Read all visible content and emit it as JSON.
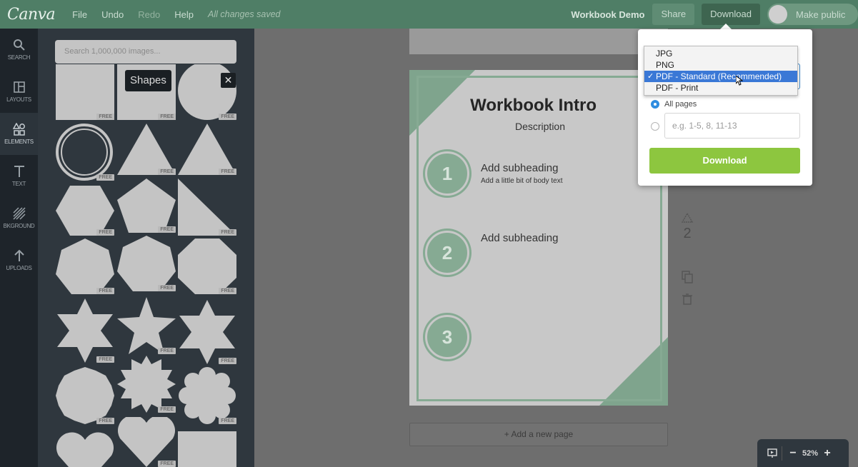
{
  "app": {
    "logo": "Canva",
    "menu": {
      "file": "File",
      "undo": "Undo",
      "redo": "Redo",
      "help": "Help",
      "saved_status": "All changes saved"
    },
    "doc_title": "Workbook Demo",
    "share_label": "Share",
    "download_label": "Download",
    "make_public_label": "Make public",
    "brand_color": "#4f7e66"
  },
  "rail": {
    "items": [
      {
        "label": "SEARCH",
        "icon": "search-icon"
      },
      {
        "label": "LAYOUTS",
        "icon": "layouts-icon"
      },
      {
        "label": "ELEMENTS",
        "icon": "elements-icon"
      },
      {
        "label": "TEXT",
        "icon": "text-icon"
      },
      {
        "label": "BKGROUND",
        "icon": "background-icon"
      },
      {
        "label": "UPLOADS",
        "icon": "upload-icon"
      }
    ]
  },
  "panel": {
    "search_placeholder": "Search 1,000,000 images...",
    "tooltip": "Shapes",
    "close_symbol": "✕",
    "free_label": "FREE"
  },
  "page": {
    "title": "Workbook Intro",
    "description": "Description",
    "steps": [
      {
        "number": "1",
        "subheading": "Add subheading",
        "body": "Add a little bit of body text"
      },
      {
        "number": "2",
        "subheading": "Add subheading",
        "body": ""
      },
      {
        "number": "3",
        "subheading": "",
        "body": ""
      }
    ],
    "page_number": "2",
    "add_page_label": "+ Add a new page",
    "accent_color": "#86aa93"
  },
  "download_popover": {
    "file_type_options": [
      "JPG",
      "PNG",
      "PDF - Standard (Recommended)",
      "PDF - Print"
    ],
    "selected_option": "PDF - Standard (Recommended)",
    "check_mark": "✓",
    "all_pages_label": "All pages",
    "range_placeholder": "e.g. 1-5, 8, 11-13",
    "button_label": "Download",
    "button_color": "#8dc63f"
  },
  "zoom": {
    "level": "52%",
    "minus": "−",
    "plus": "+"
  }
}
